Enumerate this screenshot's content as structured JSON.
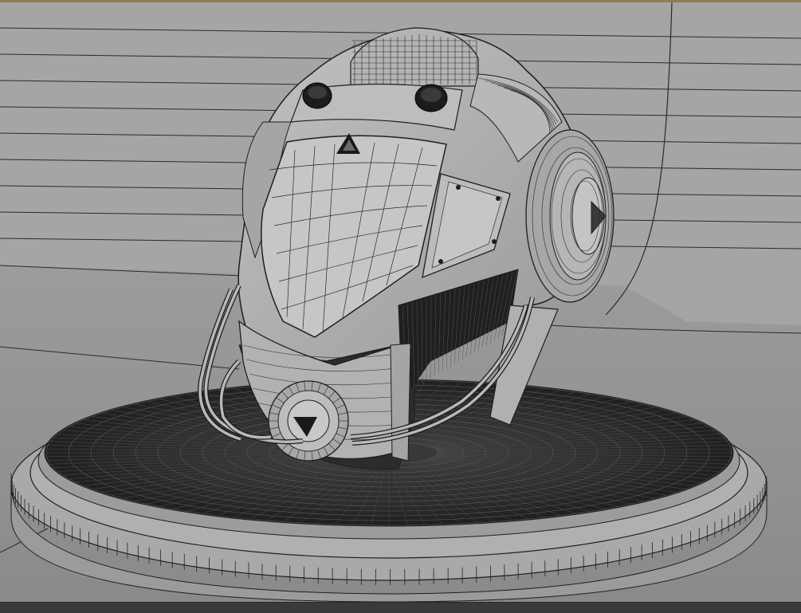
{
  "viewport": {
    "view_name": "perspective-viewport",
    "render_mode": "wireframe-on-shaded",
    "subject": "sci-fi-helmet-model-on-round-pedestal"
  },
  "colors": {
    "frame_top": "#8b7f55",
    "viewport_background": "#a3a3a3",
    "wire": "#1e1e1e",
    "bottom_bar": "#3a3a3a"
  }
}
